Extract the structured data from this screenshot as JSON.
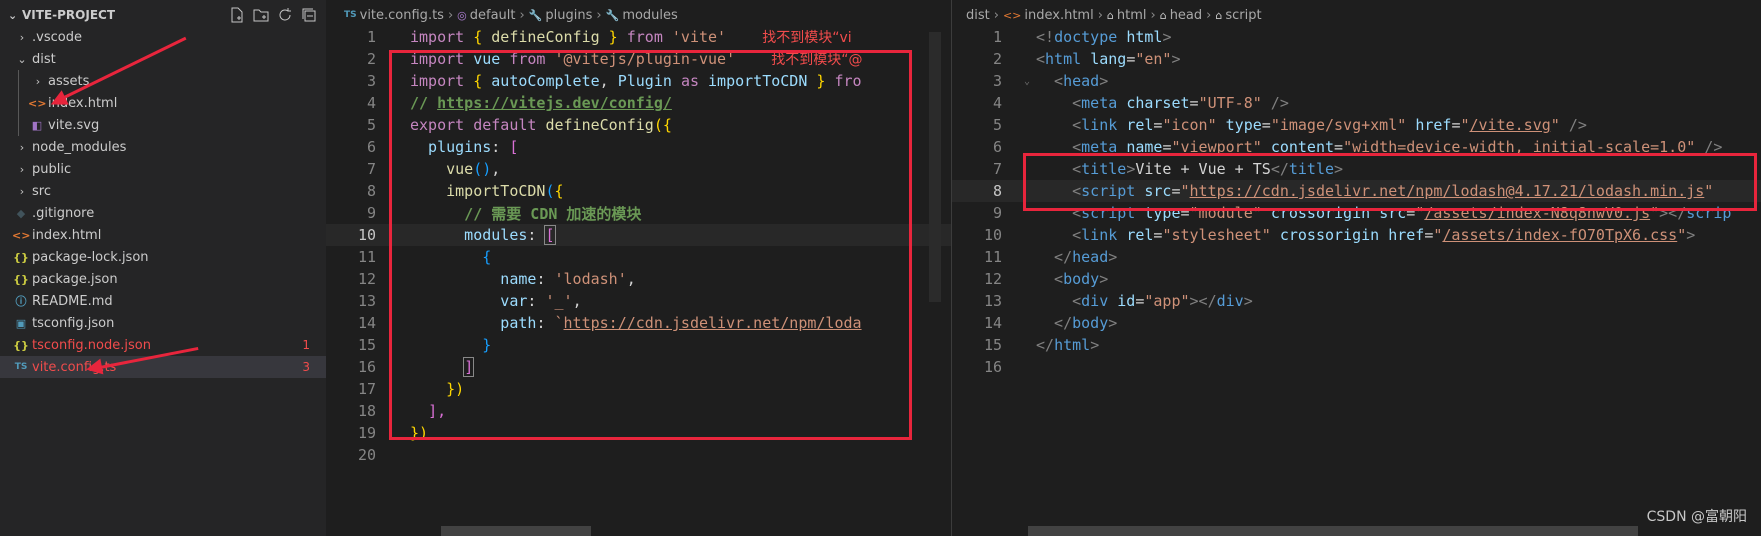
{
  "explorer": {
    "title": "VITE-PROJECT",
    "items": [
      {
        "label": ".vscode",
        "type": "folder",
        "open": false,
        "indent": 1
      },
      {
        "label": "dist",
        "type": "folder",
        "open": true,
        "indent": 1
      },
      {
        "label": "assets",
        "type": "folder",
        "open": false,
        "indent": 2
      },
      {
        "label": "index.html",
        "type": "html",
        "indent": 2,
        "icon": "<>"
      },
      {
        "label": "vite.svg",
        "type": "svg",
        "indent": 2,
        "icon": "◧"
      },
      {
        "label": "node_modules",
        "type": "folder",
        "open": false,
        "indent": 1
      },
      {
        "label": "public",
        "type": "folder",
        "open": false,
        "indent": 1
      },
      {
        "label": "src",
        "type": "folder",
        "open": false,
        "indent": 1
      },
      {
        "label": ".gitignore",
        "type": "git",
        "indent": 1,
        "icon": "◆"
      },
      {
        "label": "index.html",
        "type": "html",
        "indent": 1,
        "icon": "<>"
      },
      {
        "label": "package-lock.json",
        "type": "json",
        "indent": 1,
        "icon": "{}"
      },
      {
        "label": "package.json",
        "type": "json",
        "indent": 1,
        "icon": "{}"
      },
      {
        "label": "README.md",
        "type": "md",
        "indent": 1,
        "icon": "ⓘ"
      },
      {
        "label": "tsconfig.json",
        "type": "tsjson",
        "indent": 1,
        "icon": "▣"
      },
      {
        "label": "tsconfig.node.json",
        "type": "json",
        "indent": 1,
        "icon": "{}",
        "error": true,
        "badge": "1"
      },
      {
        "label": "vite.config.ts",
        "type": "ts",
        "indent": 1,
        "icon": "TS",
        "error": true,
        "badge": "3",
        "selected": true
      }
    ]
  },
  "editor1": {
    "breadcrumb": [
      "vite.config.ts",
      "default",
      "plugins",
      "modules"
    ],
    "breadcrumb_icons": [
      "TS",
      "◎",
      "🔧",
      "🔧"
    ],
    "error_msg_1": "找不到模块“vi",
    "error_msg_2": "找不到模块“@",
    "lines": {
      "l1a": "import",
      "l1b": " { ",
      "l1c": "defineConfig",
      "l1d": " } ",
      "l1e": "from",
      "l1f": " ",
      "l1g": "'vite'",
      "l2a": "import",
      "l2b": " ",
      "l2c": "vue",
      "l2d": " ",
      "l2e": "from",
      "l2f": " ",
      "l2g": "'@vitejs/plugin-vue'",
      "l3a": "import",
      "l3b": " { ",
      "l3c": "autoComplete",
      "l3d": ", ",
      "l3e": "Plugin",
      "l3f": " ",
      "l3g": "as",
      "l3h": " ",
      "l3i": "importToCDN",
      "l3j": " } ",
      "l3k": "fro",
      "l4a": "// ",
      "l4b": "https://vitejs.dev/config/",
      "l5a": "export",
      "l5b": " ",
      "l5c": "default",
      "l5d": " ",
      "l5e": "defineConfig",
      "l5f": "({",
      "l6a": "  plugins",
      "l6b": ": ",
      "l6c": "[",
      "l7a": "    ",
      "l7b": "vue",
      "l7c": "()",
      "l7d": ",",
      "l8a": "    ",
      "l8b": "importToCDN",
      "l8c": "(",
      "l8d": "{",
      "l9a": "      // 需要 CDN 加速的模块",
      "l10a": "      modules",
      "l10b": ": ",
      "l10c": "[",
      "l11a": "        ",
      "l11b": "{",
      "l12a": "          name",
      "l12b": ": ",
      "l12c": "'lodash'",
      "l12d": ",",
      "l13a": "          var",
      "l13b": ": ",
      "l13c": "'_'",
      "l13d": ",",
      "l14a": "          path",
      "l14b": ": ",
      "l14c": "`",
      "l14d": "https://cdn.jsdelivr.net/npm/loda",
      "l15a": "        ",
      "l15b": "}",
      "l16a": "      ",
      "l16b": "]",
      "l17a": "    ",
      "l17b": "})",
      "l18a": "  ",
      "l18b": "],",
      "l19a": "})"
    }
  },
  "editor2": {
    "breadcrumb": [
      "dist",
      "index.html",
      "html",
      "head",
      "script"
    ],
    "lines": {
      "l1a": "<!",
      "l1b": "doctype",
      "l1c": " ",
      "l1d": "html",
      "l1e": ">",
      "l2a": "<",
      "l2b": "html",
      "l2c": " ",
      "l2d": "lang",
      "l2e": "=",
      "l2f": "\"en\"",
      "l2g": ">",
      "l3a": "  <",
      "l3b": "head",
      "l3c": ">",
      "l4a": "    <",
      "l4b": "meta",
      "l4c": " ",
      "l4d": "charset",
      "l4e": "=",
      "l4f": "\"UTF-8\"",
      "l4g": " />",
      "l5a": "    <",
      "l5b": "link",
      "l5c": " ",
      "l5d": "rel",
      "l5e": "=",
      "l5f": "\"icon\"",
      "l5g": " ",
      "l5h": "type",
      "l5i": "=",
      "l5j": "\"image/svg+xml\"",
      "l5k": " ",
      "l5l": "href",
      "l5m": "=",
      "l5n": "\"",
      "l5o": "/vite.svg",
      "l5p": "\"",
      "l5q": " />",
      "l6a": "    <",
      "l6b": "meta",
      "l6c": " ",
      "l6d": "name",
      "l6e": "=",
      "l6f": "\"viewport\"",
      "l6g": " ",
      "l6h": "content",
      "l6i": "=",
      "l6j": "\"width=device-width, initial-scale=1.0\"",
      "l6k": " />",
      "l7a": "    <",
      "l7b": "title",
      "l7c": ">",
      "l7d": "Vite + Vue + TS",
      "l7e": "</",
      "l7f": "title",
      "l7g": ">",
      "l8a": "    <",
      "l8b": "script",
      "l8c": " ",
      "l8d": "src",
      "l8e": "=",
      "l8f": "\"",
      "l8g": "https://cdn.jsdelivr.net/npm/lodash@4.17.21/lodash.min.js",
      "l8h": "\"",
      "l9a": "    <",
      "l9b": "script",
      "l9c": " ",
      "l9d": "type",
      "l9e": "=",
      "l9f": "\"module\"",
      "l9g": " ",
      "l9h": "crossorigin",
      "l9i": " ",
      "l9j": "src",
      "l9k": "=",
      "l9l": "\"",
      "l9m": "/assets/index-N8q8nwV0.js",
      "l9n": "\"",
      "l9o": "></",
      "l9p": "scrip",
      "l10a": "    <",
      "l10b": "link",
      "l10c": " ",
      "l10d": "rel",
      "l10e": "=",
      "l10f": "\"stylesheet\"",
      "l10g": " ",
      "l10h": "crossorigin",
      "l10i": " ",
      "l10j": "href",
      "l10k": "=",
      "l10l": "\"",
      "l10m": "/assets/index-fO70TpX6.css",
      "l10n": "\"",
      "l10o": ">",
      "l11a": "  </",
      "l11b": "head",
      "l11c": ">",
      "l12a": "  <",
      "l12b": "body",
      "l12c": ">",
      "l13a": "    <",
      "l13b": "div",
      "l13c": " ",
      "l13d": "id",
      "l13e": "=",
      "l13f": "\"app\"",
      "l13g": "></",
      "l13h": "div",
      "l13i": ">",
      "l14a": "  </",
      "l14b": "body",
      "l14c": ">",
      "l15a": "</",
      "l15b": "html",
      "l15c": ">"
    }
  },
  "watermark": "CSDN @富朝阳",
  "colors": {
    "annotation": "#e8253c",
    "error": "#f14c4c"
  }
}
